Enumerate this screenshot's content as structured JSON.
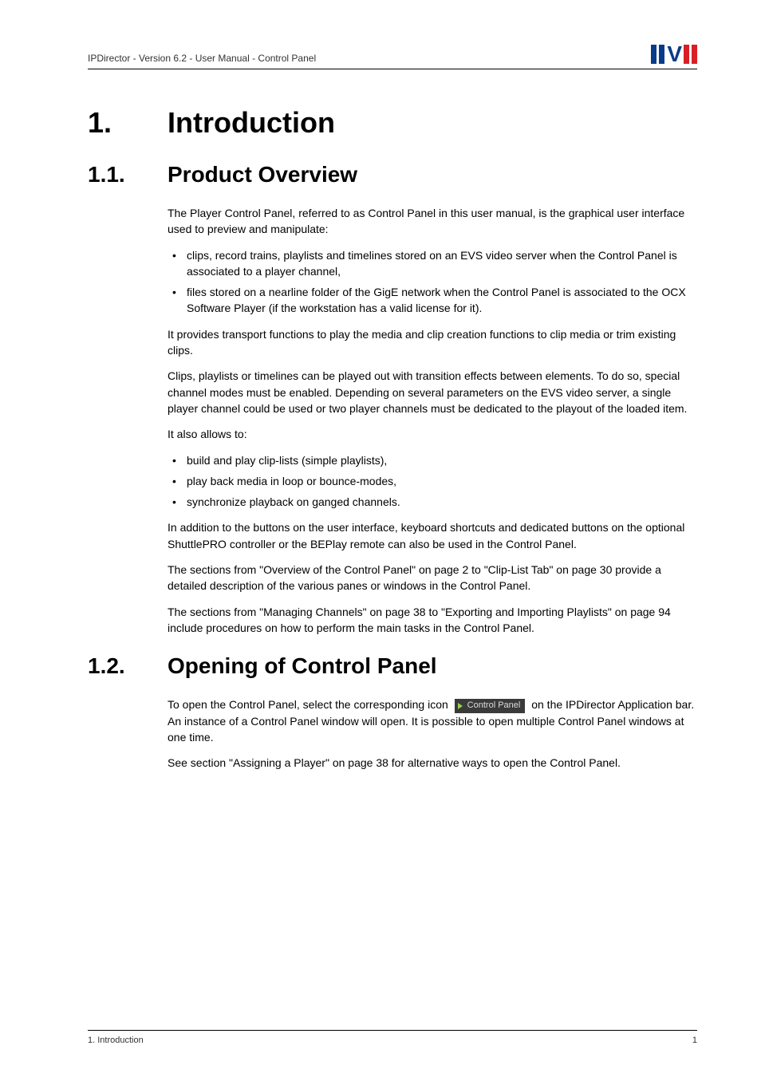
{
  "header": {
    "breadcrumb": "IPDirector - Version 6.2 - User Manual - Control Panel",
    "logo_alt": "EVS"
  },
  "h1": {
    "num": "1.",
    "title": "Introduction"
  },
  "s11": {
    "num": "1.1.",
    "title": "Product Overview",
    "p1": "The Player Control Panel, referred to as Control Panel in this user manual, is the graphical user interface used to preview and manipulate:",
    "li1": "clips, record trains, playlists and timelines stored on an EVS video server when the Control Panel is associated to a player channel,",
    "li2": "files stored on a nearline folder of the GigE network when the Control Panel is associated to the OCX Software Player (if the workstation has a valid license for it).",
    "p2": "It provides transport functions to play the media and clip creation functions to clip media or trim existing clips.",
    "p3": "Clips, playlists or timelines can be played out with transition effects between elements. To do so, special channel modes must be enabled. Depending on several parameters on the EVS video server, a single player channel could be used or two player channels must be dedicated to the playout of the loaded item.",
    "p4": "It also allows to:",
    "li3": "build and play clip-lists (simple playlists),",
    "li4": "play back media in loop or bounce-modes,",
    "li5": "synchronize playback on ganged channels.",
    "p5": "In addition to the buttons on the user interface, keyboard shortcuts and dedicated buttons on the optional ShuttlePRO controller or the BEPlay remote can also be used in the Control Panel.",
    "p6": "The sections from \"Overview of the Control Panel\" on page 2 to \"Clip-List Tab\" on page 30 provide a detailed description of the various panes or windows in the Control Panel.",
    "p7": "The sections from \"Managing Channels\" on page 38 to \"Exporting and Importing Playlists\" on page 94 include procedures on how to perform the main tasks in the Control Panel."
  },
  "s12": {
    "num": "1.2.",
    "title": "Opening of Control Panel",
    "p1a": "To open the Control Panel, select the corresponding icon ",
    "icon_label": "Control Panel",
    "p1b": " on the IPDirector Application bar. An instance of a Control Panel window will open. It is possible to open multiple Control Panel windows at one time.",
    "p2": "See section \"Assigning a Player\" on page 38 for alternative ways to open the Control Panel."
  },
  "footer": {
    "left": "1. Introduction",
    "right": "1"
  }
}
